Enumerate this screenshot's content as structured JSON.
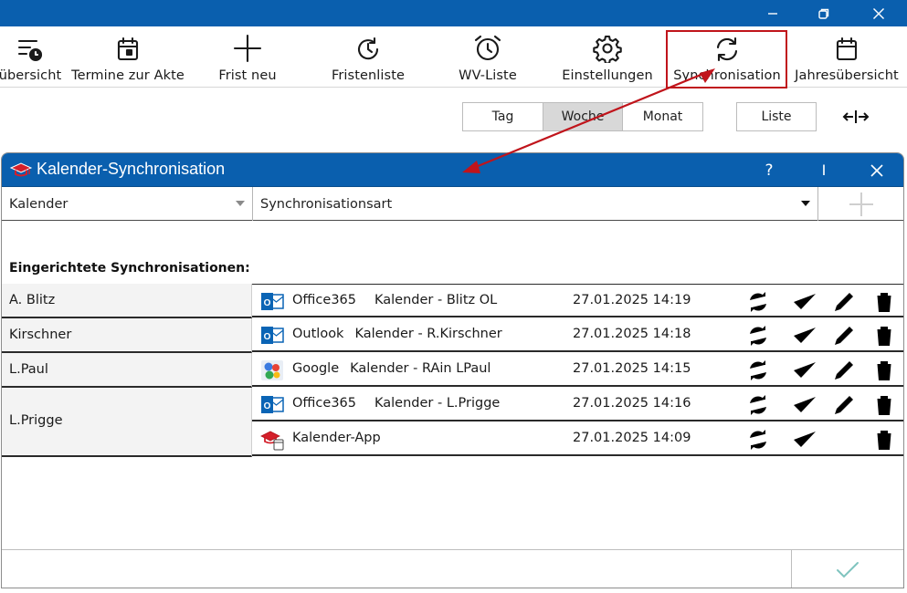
{
  "window": {
    "controls": [
      "minimize",
      "restore",
      "close"
    ]
  },
  "ribbon": {
    "items": [
      {
        "label": "übersicht",
        "icon": "list-clock-icon"
      },
      {
        "label": "Termine zur Akte",
        "icon": "calendar-icon"
      },
      {
        "label": "Frist neu",
        "icon": "plus-icon"
      },
      {
        "label": "Fristenliste",
        "icon": "clock-refresh-icon"
      },
      {
        "label": "WV-Liste",
        "icon": "alarm-clock-icon"
      },
      {
        "label": "Einstellungen",
        "icon": "gear-icon"
      },
      {
        "label": "Synchronisation",
        "icon": "sync-icon"
      },
      {
        "label": "Jahresübersicht",
        "icon": "calendar-year-icon"
      }
    ]
  },
  "view": {
    "segments": [
      "Tag",
      "Woche",
      "Monat"
    ],
    "active": "Woche",
    "list_label": "Liste"
  },
  "dialog": {
    "title": "Kalender-Synchronisation",
    "help_label": "?",
    "cursor_label": "I",
    "calendar_dropdown": "Kalender",
    "sync_type_dropdown": "Synchronisationsart",
    "section_title": "Eingerichtete Synchronisationen:",
    "users": [
      "A. Blitz",
      "Kirschner",
      "L.Paul",
      "L.Prigge"
    ],
    "rows": [
      {
        "service": "Office365",
        "calendar": "Kalender - Blitz OL",
        "timestamp": "27.01.2025 14:19",
        "icon": "outlook-icon",
        "editable": true
      },
      {
        "service": "Outlook",
        "calendar": "Kalender - R.Kirschner",
        "timestamp": "27.01.2025 14:18",
        "icon": "outlook-icon",
        "editable": true
      },
      {
        "service": "Google",
        "calendar": "Kalender - RAin LPaul",
        "timestamp": "27.01.2025 14:15",
        "icon": "google-icon",
        "editable": true
      },
      {
        "service": "Office365",
        "calendar": "Kalender - L.Prigge",
        "timestamp": "27.01.2025 14:16",
        "icon": "outlook-icon",
        "editable": true
      },
      {
        "service": "Kalender-App",
        "calendar": "",
        "timestamp": "27.01.2025 14:09",
        "icon": "kalender-app-icon",
        "editable": false
      }
    ]
  },
  "colors": {
    "titlebar": "#0a5fae",
    "highlight": "#c0141b",
    "ok_check": "#7fc4bf"
  }
}
